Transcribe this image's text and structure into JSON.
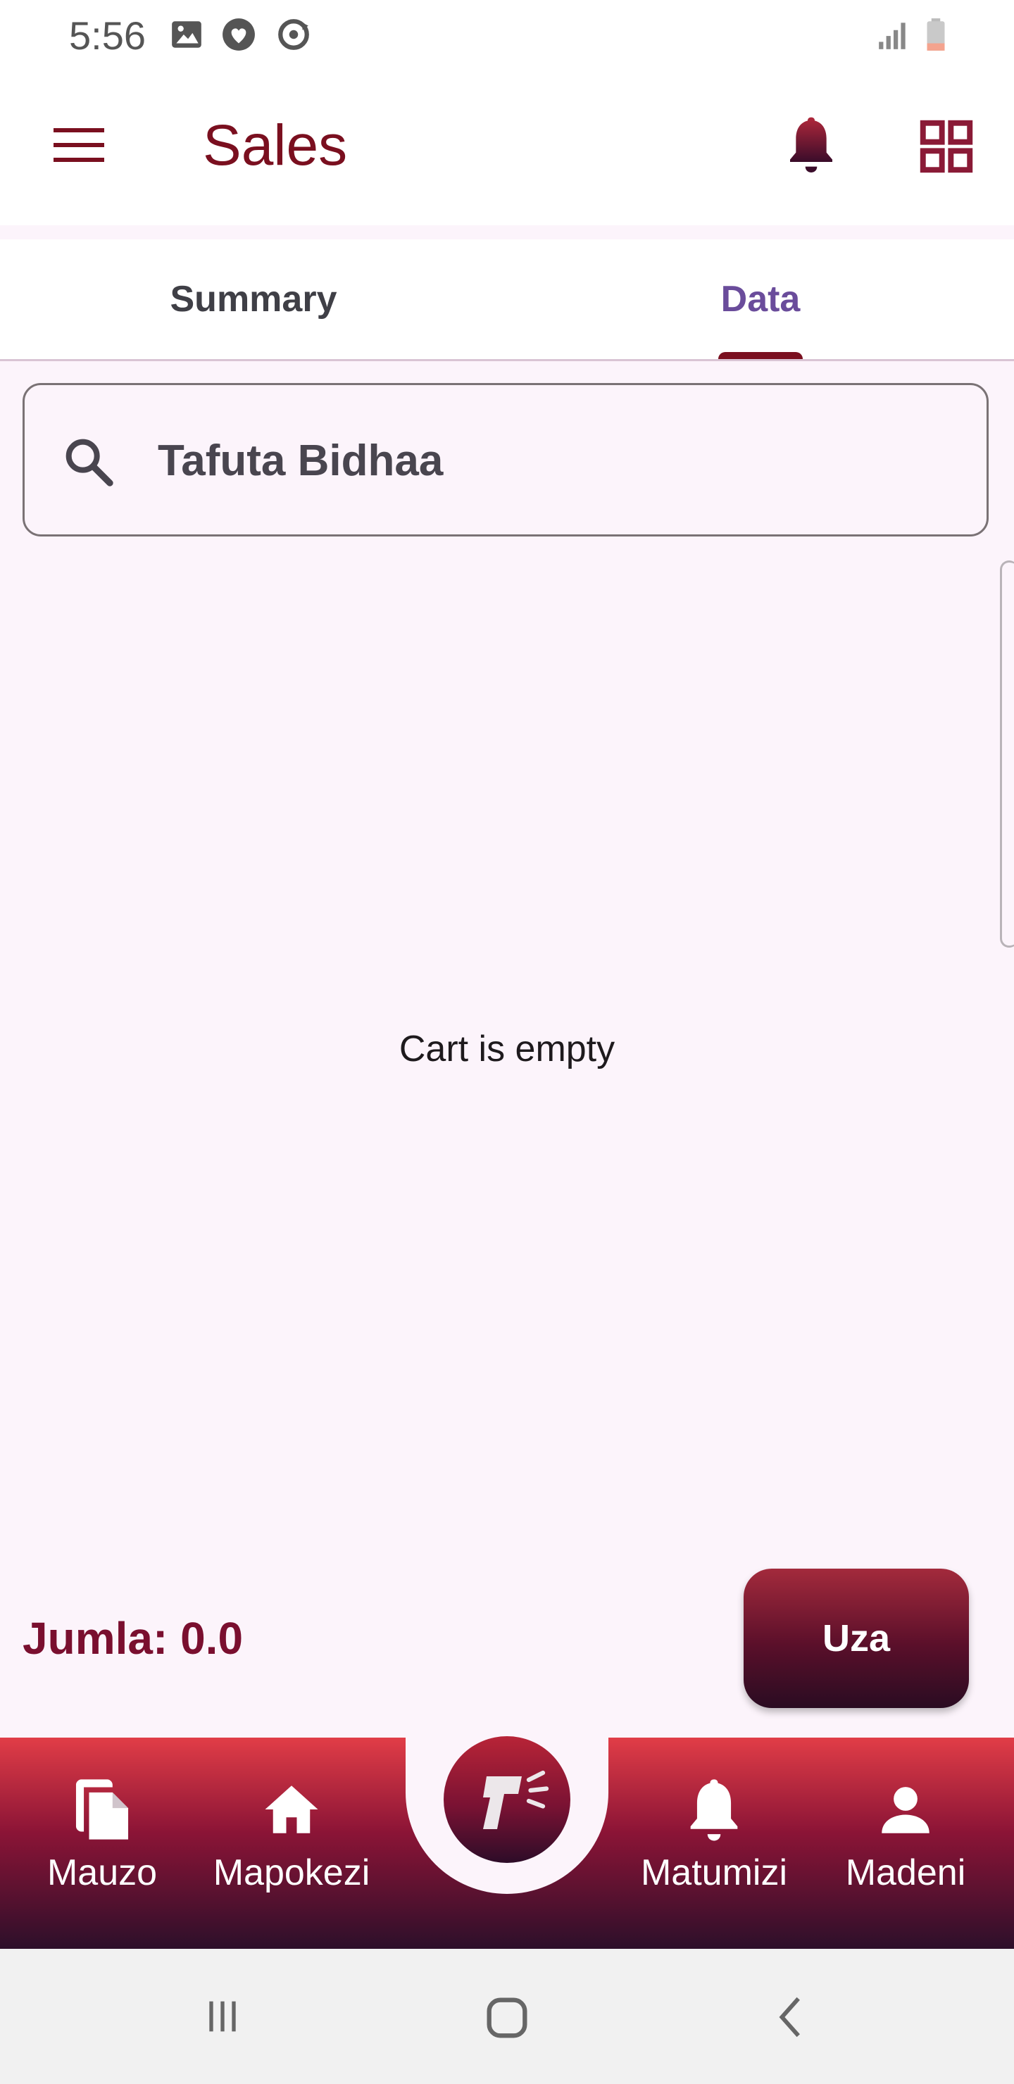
{
  "status_bar": {
    "time": "5:56",
    "icons": [
      "image-icon",
      "heart-shield-icon",
      "sync-icon",
      "signal-icon",
      "battery-icon"
    ]
  },
  "app_bar": {
    "title": "Sales",
    "menu_icon": "hamburger-menu-icon",
    "notification_icon": "bell-icon",
    "qr_icon": "grid-icon"
  },
  "tabs": [
    {
      "label": "Summary",
      "selected": false
    },
    {
      "label": "Data",
      "selected": true
    }
  ],
  "search": {
    "placeholder": "Tafuta Bidhaa",
    "value": ""
  },
  "cart": {
    "empty_message": "Cart is empty"
  },
  "footer": {
    "total_label": "Jumla: 0.0",
    "sell_label": "Uza"
  },
  "bottom_nav": {
    "items": [
      {
        "label": "Mauzo",
        "icon": "files-icon"
      },
      {
        "label": "Mapokezi",
        "icon": "home-icon"
      },
      {
        "label": "Matumizi",
        "icon": "bell-icon"
      },
      {
        "label": "Madeni",
        "icon": "person-icon"
      }
    ],
    "center_icon": "barcode-scanner-icon"
  },
  "system_nav": {
    "icons": [
      "recents-icon",
      "home-icon",
      "back-icon"
    ]
  },
  "colors": {
    "brand": "#7a0f1f",
    "tab_selected": "#6a4c9b",
    "background": "#fcf4fb"
  }
}
